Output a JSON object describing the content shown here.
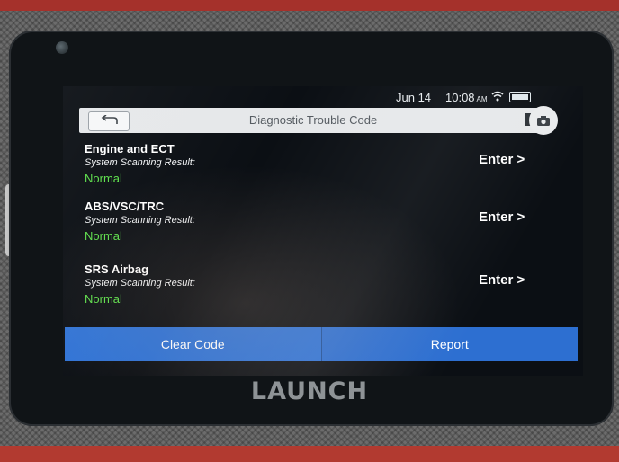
{
  "device": {
    "brand": "LAUNCH"
  },
  "status_bar": {
    "date": "Jun 14",
    "time": "10:08",
    "ampm": "AM"
  },
  "header": {
    "title": "Diagnostic Trouble Code"
  },
  "systems": [
    {
      "name": "Engine and ECT",
      "scan_label": "System Scanning Result:",
      "result": "Normal",
      "enter_label": "Enter >"
    },
    {
      "name": "ABS/VSC/TRC",
      "scan_label": "System Scanning Result:",
      "result": "Normal",
      "enter_label": "Enter >"
    },
    {
      "name": "SRS Airbag",
      "scan_label": "System Scanning Result:",
      "result": "Normal",
      "enter_label": "Enter >"
    }
  ],
  "actions": {
    "clear_code": "Clear Code",
    "report": "Report"
  },
  "colors": {
    "result_ok": "#5ce04a",
    "button_blue": "#2f73d6"
  },
  "icons": [
    "back-arrow-icon",
    "wifi-icon",
    "battery-icon",
    "bookmark-icon",
    "camera-icon"
  ]
}
